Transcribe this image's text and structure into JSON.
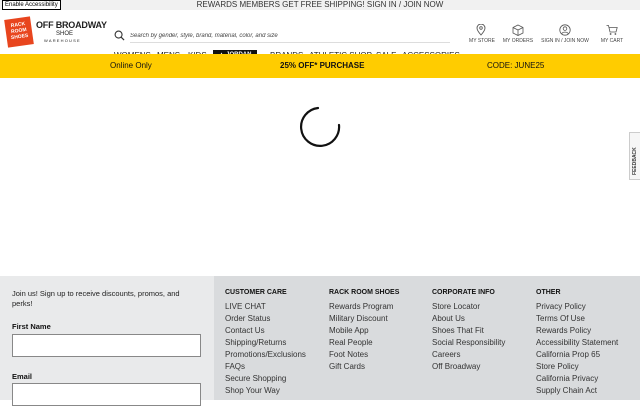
{
  "topbar": {
    "accessibility_label": "Enable Accessibility",
    "message": "REWARDS MEMBERS GET FREE SHIPPING! SIGN IN / JOIN NOW"
  },
  "logo": {
    "box_text": "RACK ROOM SHOES",
    "name": "OFF BROADWAY",
    "sub1": "SHOE",
    "sub2": "WAREHOUSE",
    "accent": "#e8451e"
  },
  "search": {
    "placeholder": "Search by gender, style, brand, material, color, and size",
    "icon": "search-icon"
  },
  "nav": {
    "womens": "WOMENS",
    "mens": "MENS",
    "kids": "KIDS",
    "jordan": "JORDAN",
    "brands": "BRANDS",
    "athletic": "ATHLETIC SHOP",
    "sale": "SALE",
    "accessories": "ACCESSORIES"
  },
  "utility": {
    "store": "MY STORE",
    "orders": "MY ORDERS",
    "signin": "SIGN IN / JOIN NOW",
    "cart": "MY CART"
  },
  "promo": {
    "left": "Online Only",
    "center": "25% OFF* PURCHASE",
    "right": "CODE: JUNE25",
    "bg": "#ffcc00"
  },
  "feedback": {
    "label": "FEEDBACK"
  },
  "signup": {
    "text": "Join us! Sign up to receive discounts, promos, and perks!",
    "first_name_label": "First Name",
    "email_label": "Email"
  },
  "footer": {
    "customer_care": {
      "title": "CUSTOMER CARE",
      "links": [
        "LIVE CHAT",
        "Order Status",
        "Contact Us",
        "Shipping/Returns",
        "Promotions/Exclusions",
        "FAQs",
        "Secure Shopping",
        "Shop Your Way"
      ]
    },
    "rack_room": {
      "title": "RACK ROOM SHOES",
      "links": [
        "Rewards Program",
        "Military Discount",
        "Mobile App",
        "Real People",
        "Foot Notes",
        "Gift Cards"
      ]
    },
    "corporate": {
      "title": "CORPORATE INFO",
      "links": [
        "Store Locator",
        "About Us",
        "Shoes That Fit",
        "Social Responsibility",
        "Careers",
        "Off Broadway"
      ]
    },
    "other": {
      "title": "OTHER",
      "links": [
        "Privacy Policy",
        "Terms Of Use",
        "Rewards Policy",
        "Accessibility Statement",
        "California Prop 65",
        "Store Policy",
        "California Privacy",
        "Supply Chain Act"
      ]
    }
  }
}
